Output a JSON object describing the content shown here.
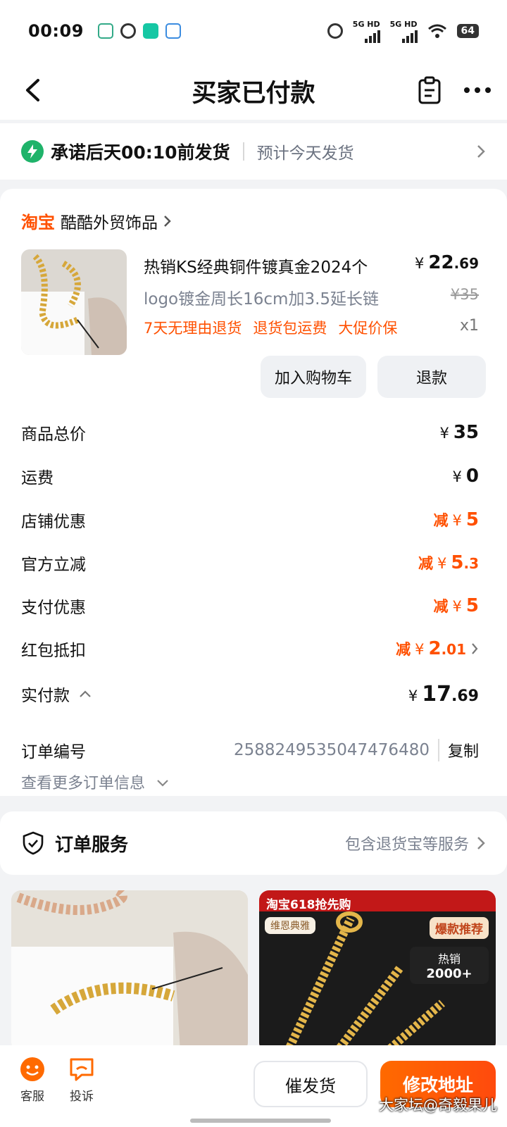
{
  "status_bar": {
    "time": "00:09",
    "net1": "5G HD",
    "net2": "5G HD",
    "battery": "64"
  },
  "header": {
    "title": "买家已付款"
  },
  "shipping": {
    "promise": "承诺后天00:10前发货",
    "estimate": "预计今天发货"
  },
  "shop": {
    "platform": "淘宝",
    "name": "酷酷外贸饰品"
  },
  "product": {
    "title": "热销KS经典铜件镀真金2024个",
    "subtitle": "logo镀金周长16cm加3.5延长链",
    "price_symbol": "¥",
    "price_int": "22",
    "price_dec": ".69",
    "original_price": "¥35",
    "qty": "x1",
    "tags": [
      "7天无理由退货",
      "退货包运费",
      "大促价保"
    ],
    "add_cart_label": "加入购物车",
    "refund_label": "退款"
  },
  "fees": [
    {
      "label": "商品总价",
      "prefix": "",
      "value": "35",
      "dec": ""
    },
    {
      "label": "运费",
      "prefix": "",
      "value": "0",
      "dec": ""
    },
    {
      "label": "店铺优惠",
      "prefix": "减",
      "value": "5",
      "dec": ""
    },
    {
      "label": "官方立减",
      "prefix": "减",
      "value": "5",
      "dec": ".3"
    },
    {
      "label": "支付优惠",
      "prefix": "减",
      "value": "5",
      "dec": ""
    },
    {
      "label": "红包抵扣",
      "prefix": "减",
      "value": "2",
      "dec": ".01"
    },
    {
      "label": "实付款",
      "prefix": "",
      "value": "17",
      "dec": ".69"
    }
  ],
  "yen": "¥",
  "order": {
    "no_label": "订单编号",
    "no": "2588249535047476480",
    "copy_label": "复制",
    "more_label": "查看更多订单信息"
  },
  "service": {
    "title": "订单服务",
    "desc": "包含退货宝等服务"
  },
  "recommend": {
    "banner": "淘宝618抢先购",
    "brand": "维恩典雅",
    "badge": "爆款推荐",
    "hot_label": "热销",
    "hot_value": "2000+"
  },
  "bottom": {
    "cs_label": "客服",
    "complaint_label": "投诉",
    "urge_label": "催发货",
    "address_label": "修改地址"
  },
  "watermark": "大家坛@奇毅果儿",
  "colors": {
    "accent": "#ff5000",
    "green": "#1fb36a"
  }
}
